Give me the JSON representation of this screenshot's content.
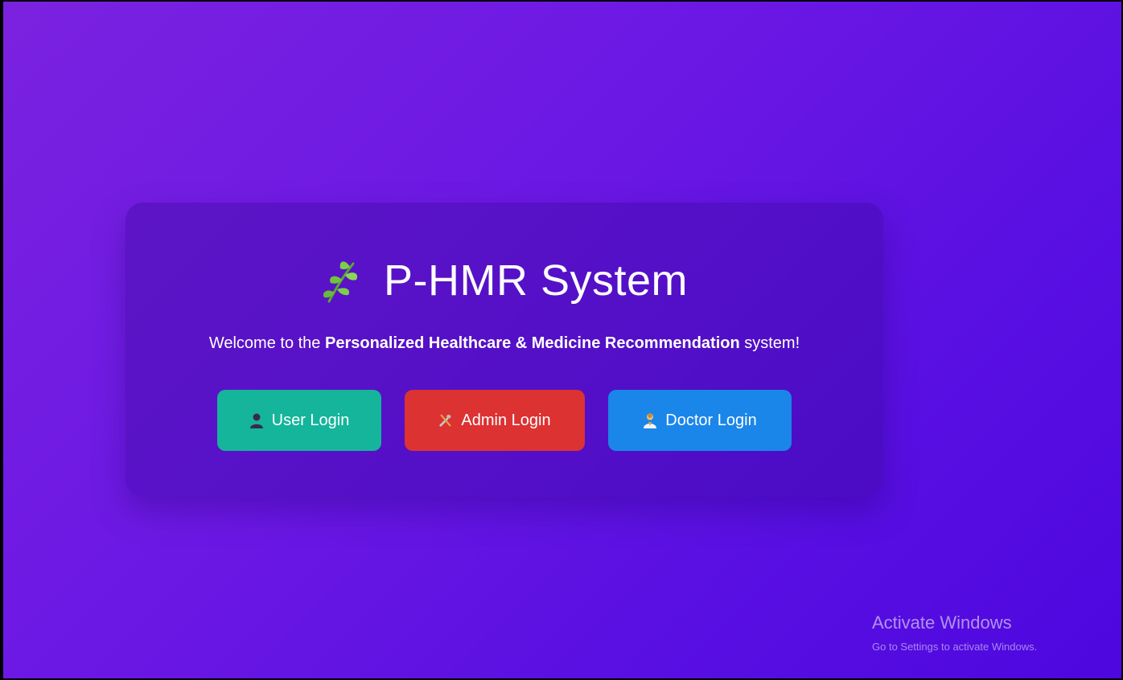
{
  "app": {
    "title": "P-HMR System",
    "welcome": {
      "prefix": "Welcome to the ",
      "emphasis": "Personalized Healthcare & Medicine Recommendation",
      "suffix": " system!"
    }
  },
  "icons": {
    "title_icon": "herb-leaf-icon",
    "user_icon": "user-silhouette-icon",
    "admin_icon": "tools-icon",
    "doctor_icon": "doctor-icon"
  },
  "buttons": {
    "user_login": "User Login",
    "admin_login": "Admin Login",
    "doctor_login": "Doctor Login"
  },
  "colors": {
    "background_start": "#7b22e0",
    "background_end": "#4d07df",
    "user_button": "#14b59b",
    "admin_button": "#dc3232",
    "doctor_button": "#1a86e9",
    "leaf_green": "#7ccf4a"
  },
  "watermark": {
    "title": "Activate Windows",
    "subtitle": "Go to Settings to activate Windows."
  }
}
